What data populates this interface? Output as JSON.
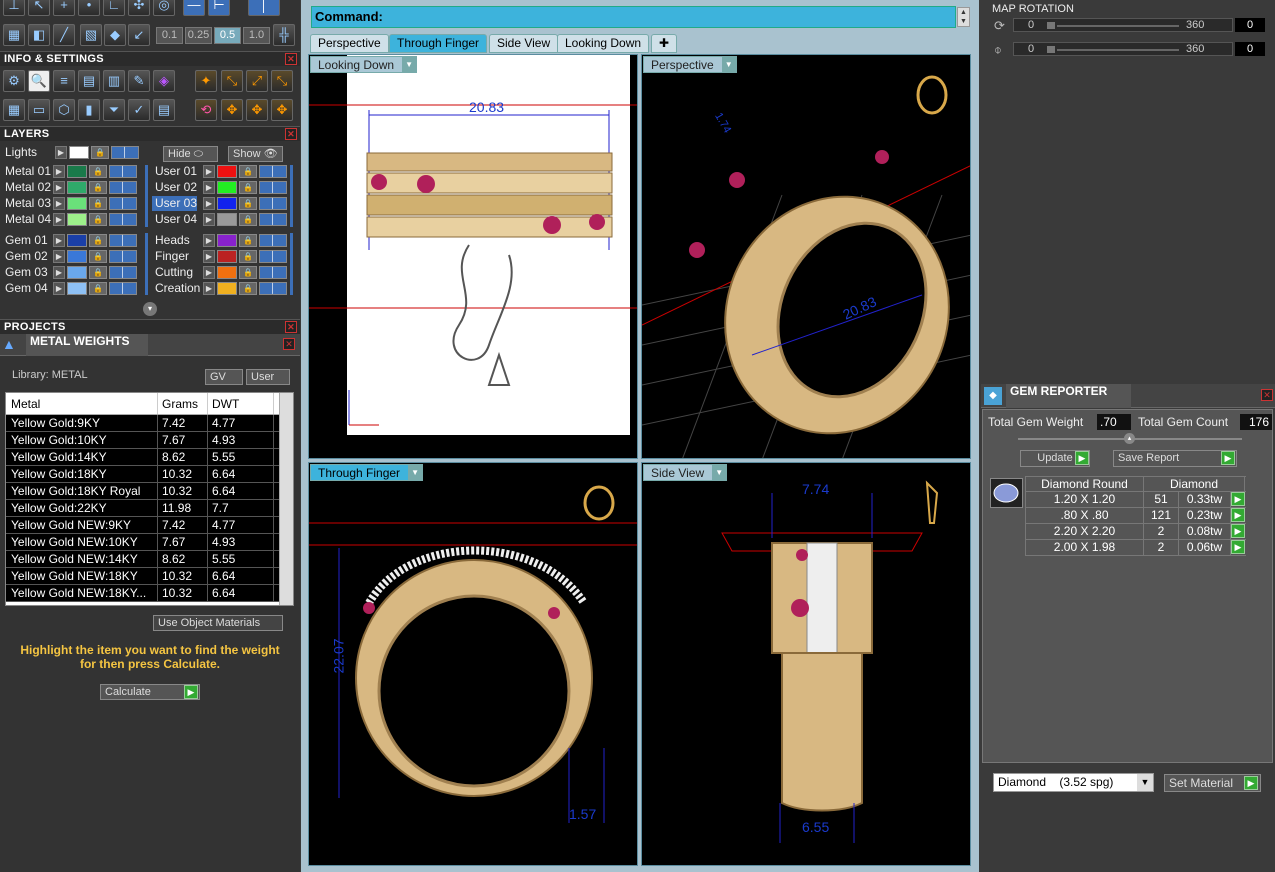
{
  "info_settings": {
    "title": "INFO & SETTINGS",
    "zoom_values": [
      "0.1",
      "0.25",
      "0.5",
      "1.0"
    ]
  },
  "layers": {
    "title": "LAYERS",
    "lights": "Lights",
    "hide": "Hide",
    "show": "Show",
    "left": [
      {
        "name": "Metal 01",
        "color": "#1a7a4a"
      },
      {
        "name": "Metal 02",
        "color": "#2faa6a"
      },
      {
        "name": "Metal 03",
        "color": "#6ae07a"
      },
      {
        "name": "Metal 04",
        "color": "#9df08a"
      },
      {
        "name": "Gem 01",
        "color": "#1a3fa8"
      },
      {
        "name": "Gem 02",
        "color": "#3a78d8"
      },
      {
        "name": "Gem 03",
        "color": "#6aa8ec"
      },
      {
        "name": "Gem 04",
        "color": "#8ec0f4"
      }
    ],
    "right": [
      {
        "name": "User 01",
        "color": "#ee1111"
      },
      {
        "name": "User 02",
        "color": "#22ee22"
      },
      {
        "name": "User 03",
        "color": "#1122ee"
      },
      {
        "name": "User 04",
        "color": "#999999"
      },
      {
        "name": "Heads",
        "color": "#8822cc"
      },
      {
        "name": "Finger",
        "color": "#bb2222"
      },
      {
        "name": "Cutting",
        "color": "#f07010"
      },
      {
        "name": "Creation",
        "color": "#f0b020"
      }
    ]
  },
  "projects": {
    "title": "PROJECTS"
  },
  "metal_weights": {
    "title": "METAL WEIGHTS",
    "library": "Library: METAL",
    "gv": "GV",
    "user": "User",
    "columns": [
      "Metal",
      "Grams",
      "DWT"
    ],
    "rows": [
      [
        "Yellow Gold:9KY",
        "7.42",
        "4.77"
      ],
      [
        "Yellow Gold:10KY",
        "7.67",
        "4.93"
      ],
      [
        "Yellow Gold:14KY",
        "8.62",
        "5.55"
      ],
      [
        "Yellow Gold:18KY",
        "10.32",
        "6.64"
      ],
      [
        "Yellow Gold:18KY Royal",
        "10.32",
        "6.64"
      ],
      [
        "Yellow Gold:22KY",
        "11.98",
        "7.7"
      ],
      [
        "Yellow Gold NEW:9KY",
        "7.42",
        "4.77"
      ],
      [
        "Yellow Gold NEW:10KY",
        "7.67",
        "4.93"
      ],
      [
        "Yellow Gold NEW:14KY",
        "8.62",
        "5.55"
      ],
      [
        "Yellow Gold NEW:18KY",
        "10.32",
        "6.64"
      ],
      [
        "Yellow Gold NEW:18KY...",
        "10.32",
        "6.64"
      ]
    ],
    "use_object_materials": "Use Object Materials",
    "hint": "Highlight the item you want to find the weight for then press Calculate.",
    "calculate": "Calculate"
  },
  "command": {
    "label": "Command:"
  },
  "tabs": [
    "Perspective",
    "Through Finger",
    "Side View",
    "Looking Down"
  ],
  "viewports": {
    "top_left": {
      "label": "Looking Down",
      "dim": "20.83"
    },
    "top_right": {
      "label": "Perspective",
      "dim": "20.83",
      "dim2": "1.74"
    },
    "bottom_left": {
      "label": "Through Finger",
      "dim": "22.07",
      "dim2": "1.57"
    },
    "bottom_right": {
      "label": "Side View",
      "dim": "7.74",
      "dim2": "6.55"
    }
  },
  "map_rotation": {
    "title": "MAP ROTATION",
    "rows": [
      {
        "min": "0",
        "max": "360",
        "value": "0"
      },
      {
        "min": "0",
        "max": "360",
        "value": "0"
      }
    ]
  },
  "gem_reporter": {
    "title": "GEM REPORTER",
    "total_weight_label": "Total Gem Weight",
    "total_weight": ".70",
    "total_count_label": "Total Gem Count",
    "total_count": "176",
    "update": "Update",
    "save_report": "Save Report",
    "header": [
      "Diamond Round",
      "Diamond"
    ],
    "rows": [
      [
        "1.20 X 1.20",
        "51",
        "0.33tw"
      ],
      [
        ".80 X .80",
        "121",
        "0.23tw"
      ],
      [
        "2.20 X 2.20",
        "2",
        "0.08tw"
      ],
      [
        "2.00 X 1.98",
        "2",
        "0.06tw"
      ]
    ],
    "material": "Diamond    (3.52 spg)",
    "set_material": "Set Material"
  }
}
